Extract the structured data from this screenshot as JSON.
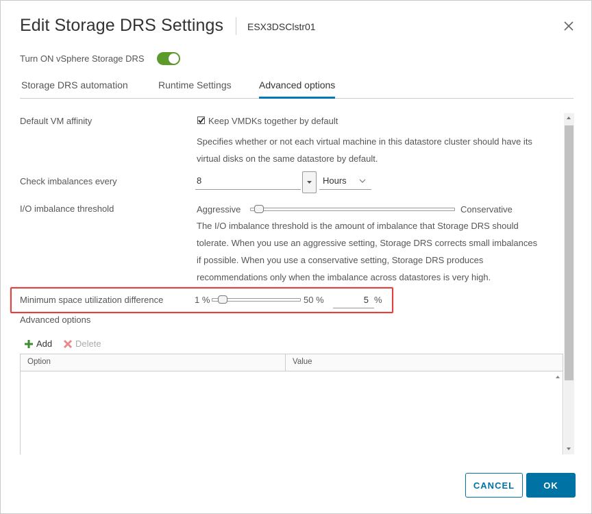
{
  "dialog": {
    "title": "Edit Storage DRS Settings",
    "subtitle": "ESX3DSClstr01"
  },
  "toggle": {
    "label": "Turn ON vSphere Storage DRS",
    "on": true,
    "color": "#5b9a2b"
  },
  "tabs": [
    {
      "label": "Storage DRS automation",
      "active": false
    },
    {
      "label": "Runtime Settings",
      "active": false
    },
    {
      "label": "Advanced options",
      "active": true
    }
  ],
  "affinity": {
    "label": "Default VM affinity",
    "checkbox_label": "Keep VMDKs together by default",
    "checked": true,
    "desc_line1": "Specifies whether or not each virtual machine in this datastore cluster should have its",
    "desc_line2": "virtual disks on the same datastore by default."
  },
  "imbalance": {
    "label": "Check imbalances every",
    "value": "8",
    "unit": "Hours"
  },
  "io_threshold": {
    "label": "I/O imbalance threshold",
    "min_label": "Aggressive",
    "max_label": "Conservative",
    "level": 0.0,
    "desc_line1": "The I/O imbalance threshold is the amount of imbalance that Storage DRS should",
    "desc_line2": "tolerate. When you use an aggressive setting, Storage DRS corrects small imbalances",
    "desc_line3": "if possible. When you use a conservative setting, Storage DRS produces",
    "desc_line4": "recommendations only when the imbalance across datastores is very high."
  },
  "space_util": {
    "label": "Minimum space utilization difference",
    "min_label": "1 %",
    "max_label": "50 %",
    "value": "5",
    "unit": "%",
    "level_percent": 5
  },
  "advanced": {
    "heading": "Advanced options",
    "add_label": "Add",
    "delete_label": "Delete",
    "columns": [
      "Option",
      "Value"
    ]
  },
  "footer": {
    "cancel_label": "CANCEL",
    "ok_label": "OK"
  },
  "colors": {
    "accent": "#0072a3",
    "highlight": "#e0413f",
    "add_icon": "#3c8d2f",
    "delete_icon": "#e88a8a"
  }
}
